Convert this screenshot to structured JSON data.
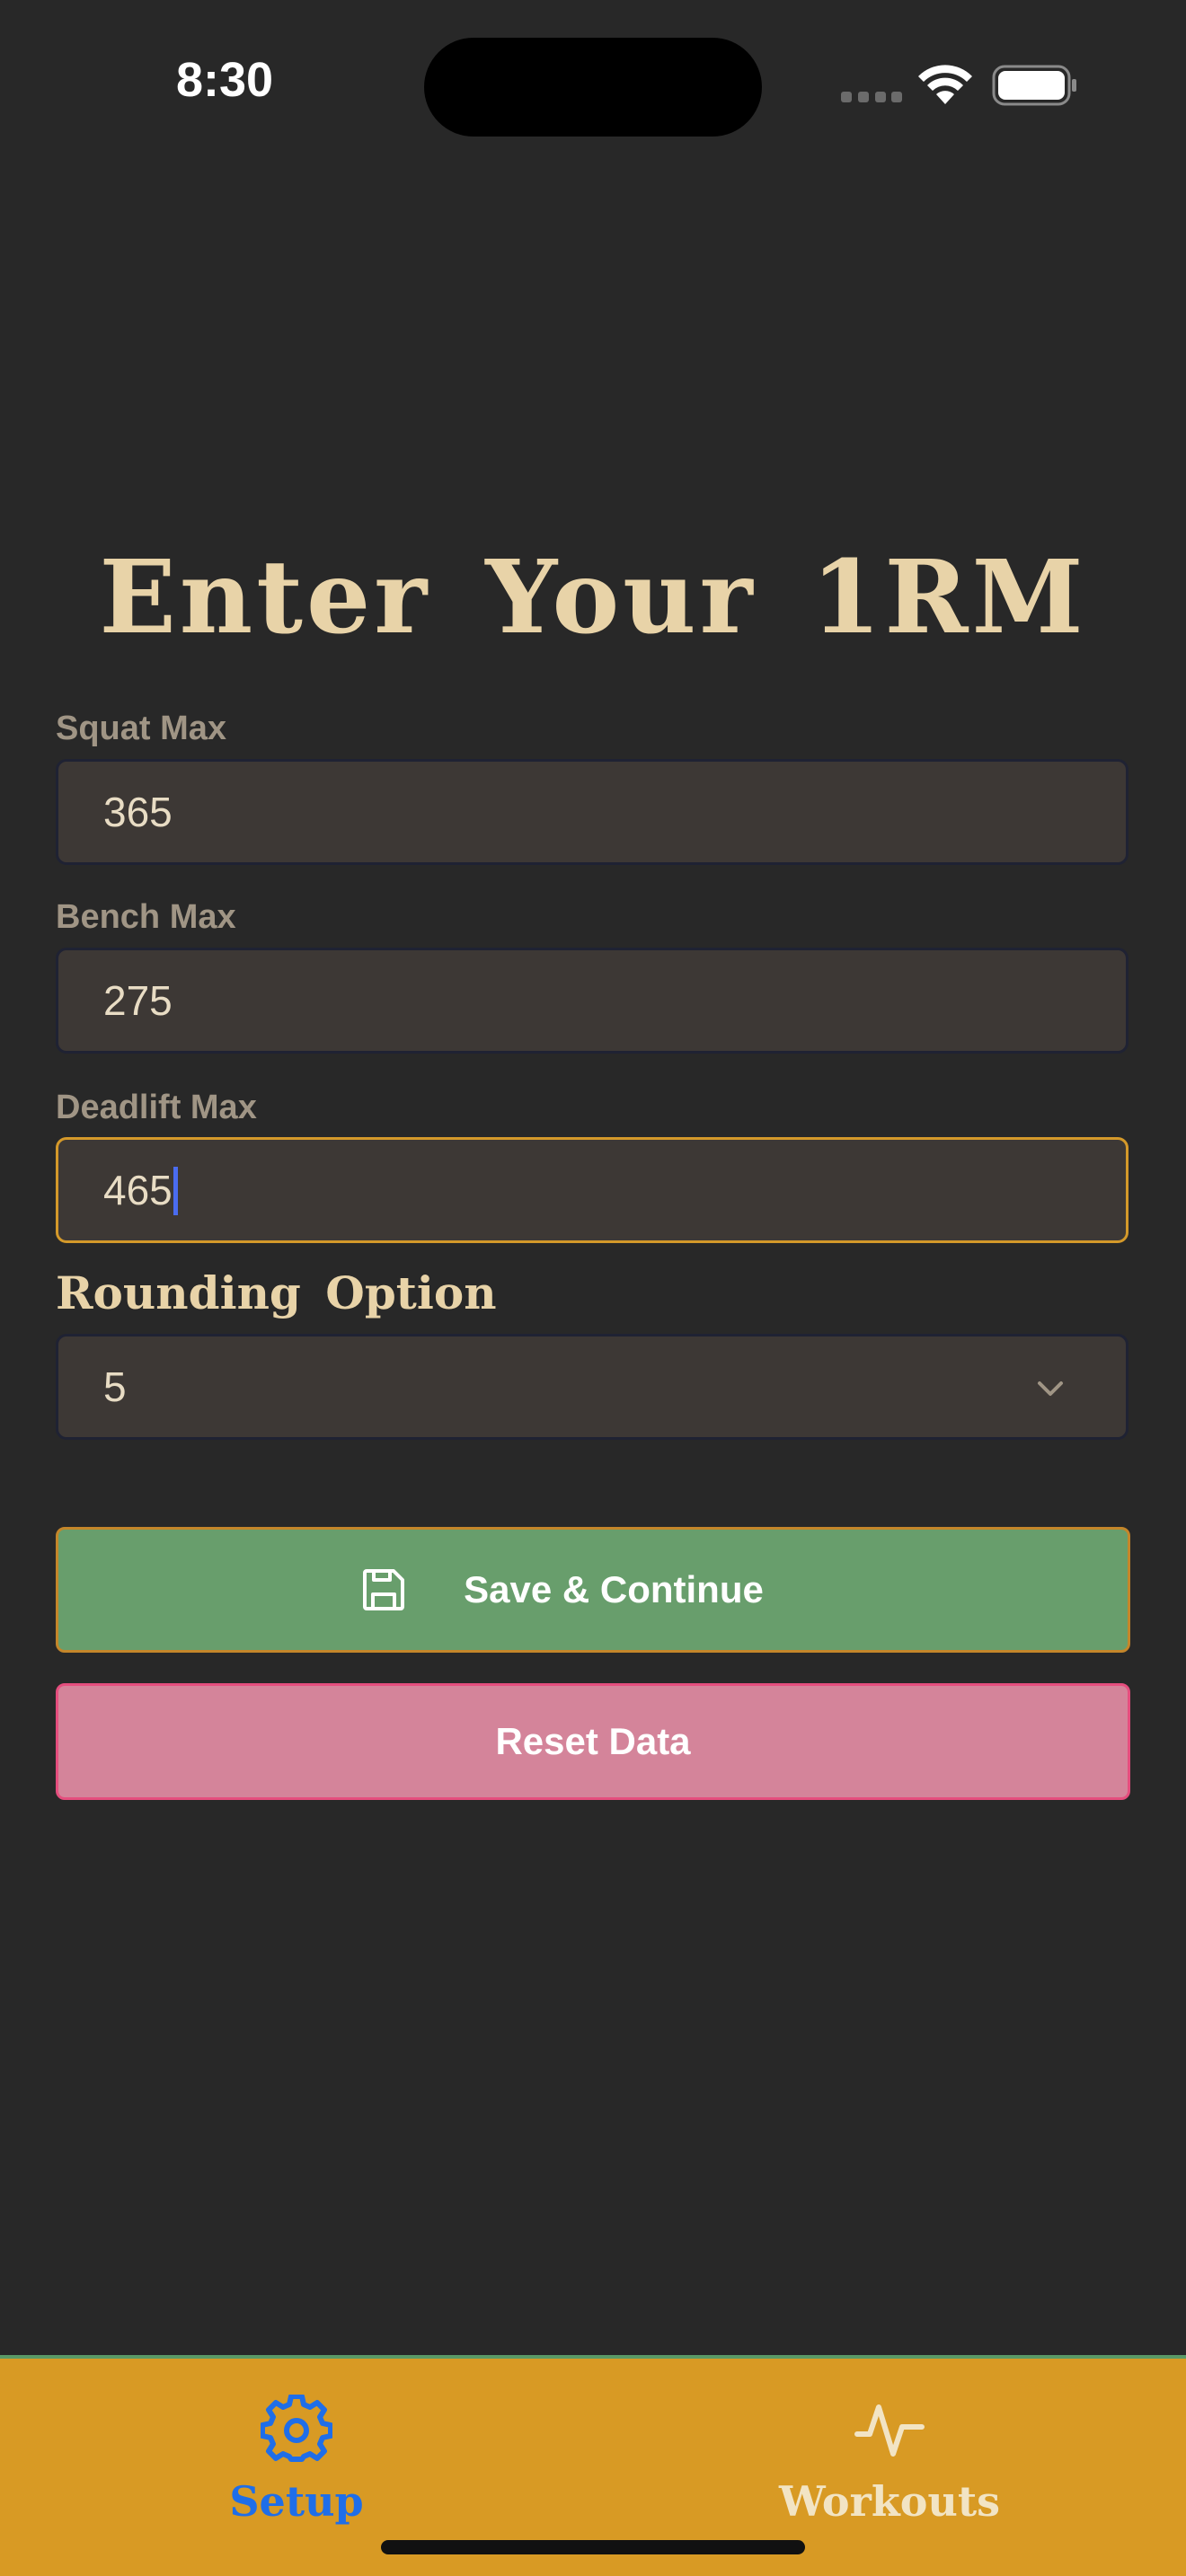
{
  "status_bar": {
    "time": "8:30"
  },
  "page": {
    "title": "Enter Your 1RM"
  },
  "form": {
    "squat": {
      "label": "Squat Max",
      "value": "365"
    },
    "bench": {
      "label": "Bench Max",
      "value": "275"
    },
    "deadlift": {
      "label": "Deadlift Max",
      "value": "465"
    },
    "rounding": {
      "heading": "Rounding Option",
      "selected": "5"
    }
  },
  "actions": {
    "save_label": "Save & Continue",
    "reset_label": "Reset Data"
  },
  "tab_bar": {
    "tabs": [
      {
        "label": "Setup",
        "icon": "gear-icon",
        "active": true
      },
      {
        "label": "Workouts",
        "icon": "activity-icon",
        "active": false
      }
    ]
  },
  "colors": {
    "background": "#282828",
    "title": "#e8d3a8",
    "field_bg": "#3d3835",
    "focus_border": "#d4992a",
    "save_button": "#689e6c",
    "reset_button": "#d4849a",
    "tab_bar": "#d89a24",
    "active_tab": "#1f6ee8"
  }
}
